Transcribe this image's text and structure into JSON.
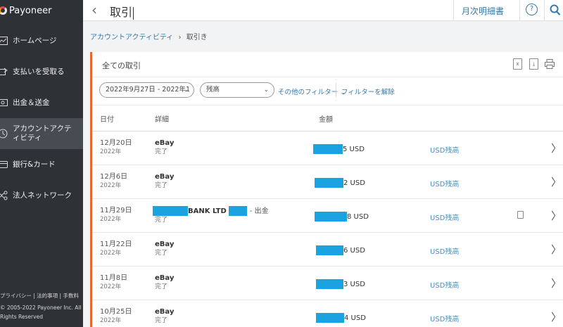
{
  "sidebar": {
    "brand": "Payoneer",
    "items": [
      {
        "label": "ホームページ",
        "icon": "line-chart-icon"
      },
      {
        "label": "支払いを受取る",
        "icon": "receive-payment-icon"
      },
      {
        "label": "出金＆送金",
        "icon": "money-transfer-icon"
      },
      {
        "label": "アカウントアクティビティ",
        "icon": "activity-icon",
        "active": true
      },
      {
        "label": "銀行&カード",
        "icon": "card-icon"
      },
      {
        "label": "法人ネットワーク",
        "icon": "network-icon"
      }
    ],
    "footer_links": "プライバシー | 法的事項 | 手数料",
    "copyright_line1": "© 2005-2022 Payoneer Inc. All",
    "copyright_line2": "Rights Reserved"
  },
  "header": {
    "back_icon": "chevron-left-icon",
    "title": "取引",
    "monthly_statement": "月次明細書",
    "help": "?"
  },
  "breadcrumb": {
    "parent": "アカウントアクティビティ",
    "separator": "›",
    "current": "取引き"
  },
  "card": {
    "title": "全ての取引",
    "export_icons": [
      "excel-export-icon",
      "pdf-export-icon",
      "print-icon"
    ],
    "accent_color": "#e8692d"
  },
  "filters": {
    "date_range": "2022年9月27日 - 2022年1",
    "balance": "残高",
    "more_filters": "その他のフィルター",
    "clear_filters": "フィルターを解除"
  },
  "table": {
    "columns": {
      "date": "日付",
      "detail": "詳細",
      "amount": "金額"
    },
    "rows": [
      {
        "date": "12月20日",
        "year": "2022年",
        "name": "eBay",
        "status": "完了",
        "amount_suffix": "5 USD",
        "balance": "USD残高"
      },
      {
        "date": "12月6日",
        "year": "2022年",
        "name": "eBay",
        "status": "完了",
        "amount_suffix": "2 USD",
        "balance": "USD残高"
      },
      {
        "date": "11月29日",
        "year": "2022年",
        "name": "BANK LTD",
        "name_suffix": "- 出金",
        "status": "完了",
        "amount_suffix": "8 USD",
        "balance": "USD残高",
        "has_file": true
      },
      {
        "date": "11月22日",
        "year": "2022年",
        "name": "eBay",
        "status": "完了",
        "amount_suffix": "6 USD",
        "balance": "USD残高"
      },
      {
        "date": "11月8日",
        "year": "2022年",
        "name": "eBay",
        "status": "完了",
        "amount_suffix": "3 USD",
        "balance": "USD残高"
      },
      {
        "date": "10月25日",
        "year": "2022年",
        "name": "eBay",
        "status": "完了",
        "amount_suffix": "4 USD",
        "balance": "USD残高"
      }
    ]
  },
  "colors": {
    "sidebar_bg": "#2e3236",
    "link": "#3479a8",
    "redaction": "#1aa3e0"
  }
}
